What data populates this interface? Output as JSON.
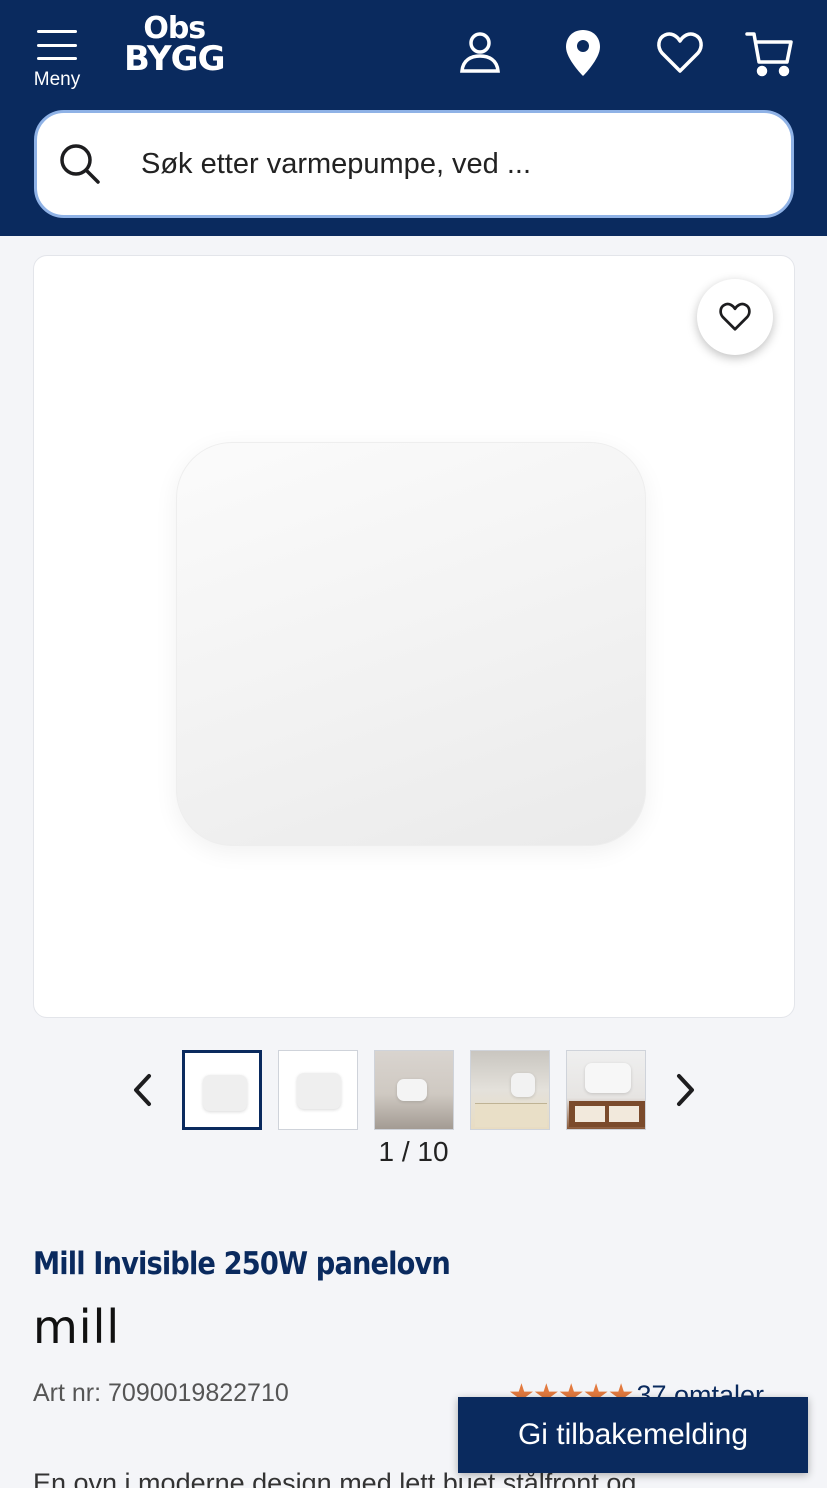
{
  "header": {
    "menu_label": "Meny",
    "logo_line1": "Obs",
    "logo_line2": "BYGG",
    "icons": [
      "account-icon",
      "location-icon",
      "heart-icon",
      "cart-icon"
    ]
  },
  "search": {
    "placeholder": "Søk etter varmepumpe, ved ..."
  },
  "gallery": {
    "counter": "1 / 10",
    "thumbnails": [
      "thumb-1",
      "thumb-2",
      "thumb-3",
      "thumb-4",
      "thumb-5"
    ],
    "active_index": 1
  },
  "product": {
    "title": "Mill Invisible 250W panelovn",
    "brand": "mill",
    "art_nr": "Art nr: 7090019822710",
    "rating_stars": "★★★★★",
    "rating_value": 4.5,
    "reviews": "37 omtaler",
    "description": "En ovn i moderne design med lett buet stålfront og"
  },
  "feedback_button": "Gi tilbakemelding",
  "colors": {
    "brand_navy": "#0a2a5e",
    "star_orange": "#e27a3f",
    "search_border": "#8fb2e6"
  }
}
